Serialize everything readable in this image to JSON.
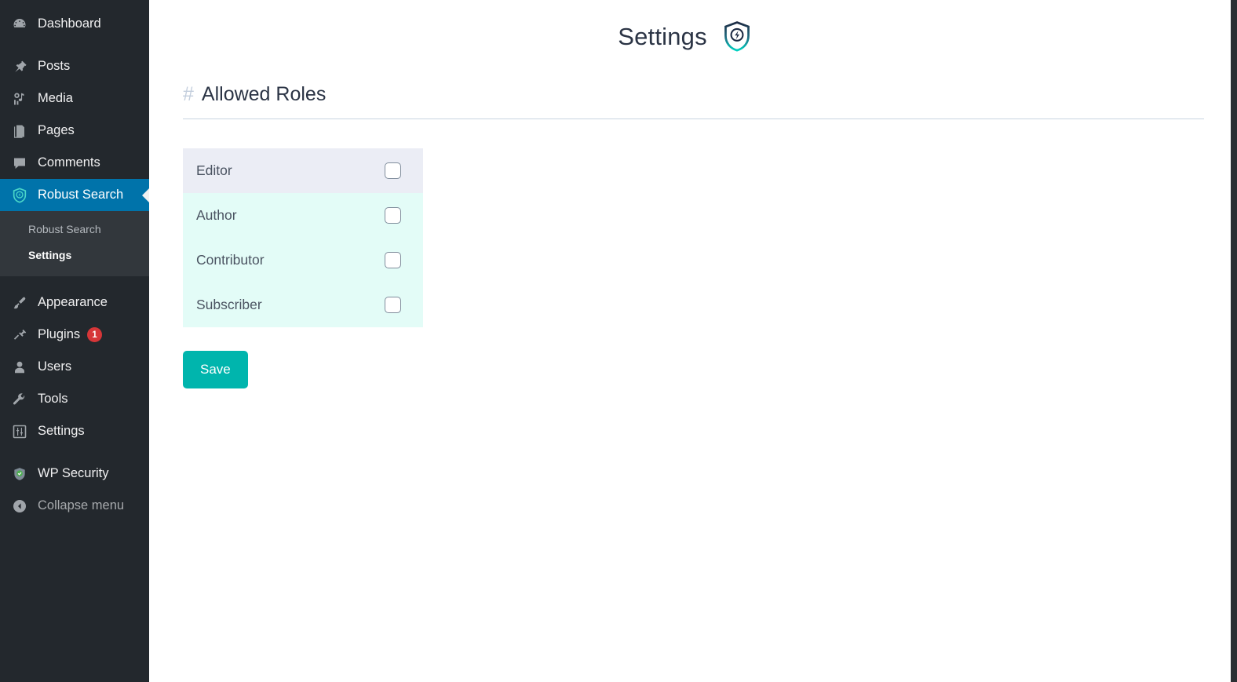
{
  "sidebar": {
    "items": [
      {
        "label": "Dashboard",
        "icon": "dashboard-icon",
        "name": "sidebar-item-dashboard"
      },
      {
        "label": "Posts",
        "icon": "pin-icon",
        "name": "sidebar-item-posts"
      },
      {
        "label": "Media",
        "icon": "media-icon",
        "name": "sidebar-item-media"
      },
      {
        "label": "Pages",
        "icon": "pages-icon",
        "name": "sidebar-item-pages"
      },
      {
        "label": "Comments",
        "icon": "comment-icon",
        "name": "sidebar-item-comments"
      },
      {
        "label": "Robust Search",
        "icon": "shield-bolt-icon",
        "name": "sidebar-item-robust-search"
      },
      {
        "label": "Appearance",
        "icon": "brush-icon",
        "name": "sidebar-item-appearance"
      },
      {
        "label": "Plugins",
        "icon": "plug-icon",
        "name": "sidebar-item-plugins",
        "badge": "1"
      },
      {
        "label": "Users",
        "icon": "user-icon",
        "name": "sidebar-item-users"
      },
      {
        "label": "Tools",
        "icon": "wrench-icon",
        "name": "sidebar-item-tools"
      },
      {
        "label": "Settings",
        "icon": "sliders-icon",
        "name": "sidebar-item-settings"
      },
      {
        "label": "WP Security",
        "icon": "shield-check-icon",
        "name": "sidebar-item-wp-security"
      },
      {
        "label": "Collapse menu",
        "icon": "collapse-arrow-icon",
        "name": "sidebar-item-collapse-menu"
      }
    ],
    "submenu": {
      "parent": "Robust Search",
      "items": [
        {
          "label": "Robust Search",
          "current": false
        },
        {
          "label": "Settings",
          "current": true
        }
      ]
    },
    "colors": {
      "background": "#23282d",
      "submenu_background": "#32373c",
      "active_background": "#0073aa",
      "badge_background": "#d63638"
    }
  },
  "header": {
    "title": "Settings",
    "logo": "shield-bolt-logo"
  },
  "section": {
    "hash": "#",
    "title": "Allowed Roles"
  },
  "roles": [
    {
      "label": "Editor",
      "checked": false,
      "hovered": true
    },
    {
      "label": "Author",
      "checked": false,
      "hovered": false
    },
    {
      "label": "Contributor",
      "checked": false,
      "hovered": false
    },
    {
      "label": "Subscriber",
      "checked": false,
      "hovered": false
    }
  ],
  "actions": {
    "save_label": "Save"
  },
  "colors": {
    "accent_teal": "#00b5ad",
    "row_background": "#e3fcf7",
    "row_hover_background": "#ebedf5",
    "heading_text": "#2b3445",
    "rule": "#c8d4e0"
  }
}
